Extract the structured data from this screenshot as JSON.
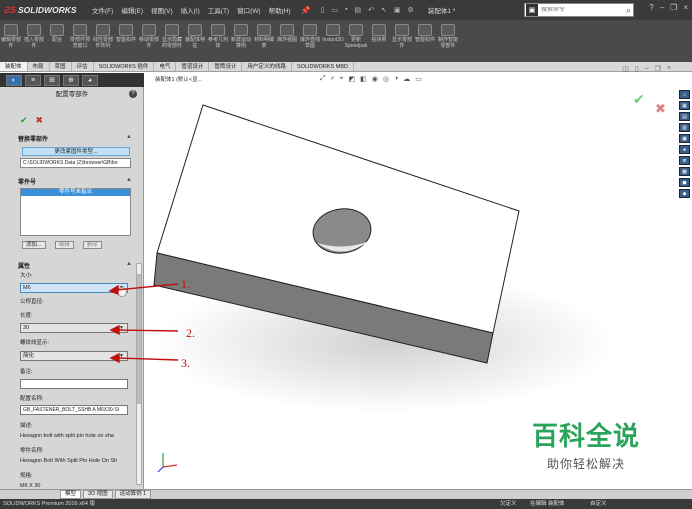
{
  "titlebar": {
    "brand": "SOLIDWORKS",
    "menu": [
      "文件(F)",
      "编辑(E)",
      "视图(V)",
      "插入(I)",
      "工具(T)",
      "窗口(W)",
      "帮助(H)"
    ],
    "doc_title": "装配体1 *",
    "search_placeholder": "搜索命令"
  },
  "ribbon": [
    "编辑零部件",
    "插入零部件",
    "配合",
    "零部件预览窗口",
    "线性零部件阵列",
    "智能扣件",
    "移动零部件",
    "显示隐藏的零部件",
    "装配体特征",
    "参考几何体",
    "新建运动算例",
    "材料明细表",
    "爆炸视图",
    "爆炸直线草图",
    "Instant3D",
    "更新Speedpak",
    "拍快照",
    "显示零部件",
    "智能扣件",
    "制作智能零部件"
  ],
  "tabs": [
    "装配体",
    "布局",
    "草图",
    "评估",
    "SOLIDWORKS 插件",
    "电气",
    "管道设计",
    "管筒设计",
    "用户定义的线路",
    "SOLIDWORKS MBD"
  ],
  "panel": {
    "title": "配置零部件",
    "sections": {
      "replace": "替换零部件",
      "part_number": "零件号",
      "properties": "属性"
    },
    "change_type_button": "更改紧固件类型...",
    "path": "C:\\SOLIDWORKS Data (2)\\browser\\GB\\bo",
    "part_list": [
      "零件号未指派"
    ],
    "buttons": {
      "add": "添加...",
      "edit": "编辑",
      "delete": "删除"
    },
    "labels": {
      "size": "大小:",
      "nominal_dia": "公称直径:",
      "length": "长度:",
      "thread_display": "螺纹线显示:",
      "comment": "备注:",
      "config_name": "配置名称:",
      "description": "描述:",
      "part_name": "零件名称:",
      "spec": "规格:"
    },
    "values": {
      "size": "M6",
      "length": "30",
      "thread_display": "简化",
      "comment": "",
      "config_name": "GB_FASTENER_BOLT_SSHB A M6X30-SI",
      "description": "Hexagon bolt with split pin hole on sha",
      "part_name": "Hexagon Bolt With Split Pin Hole On Sh",
      "spec": "M6 X 30"
    }
  },
  "viewport": {
    "breadcrumb": "装配体1 (默认<显..."
  },
  "annotations": [
    "1.",
    "2.",
    "3."
  ],
  "bottom_tabs": [
    "模型",
    "3D 视图",
    "运动算例 1"
  ],
  "status": {
    "left": "SOLIDWORKS Premium 2016 x64 版",
    "s1": "欠定义",
    "s2": "在编辑 装配体",
    "s3": "自定义"
  },
  "watermark": {
    "title": "百科全说",
    "subtitle": "助你轻松解决"
  },
  "colors": {
    "accent": "#3a8fd8",
    "annotation": "#c01010",
    "watermark": "#2aa45a"
  }
}
